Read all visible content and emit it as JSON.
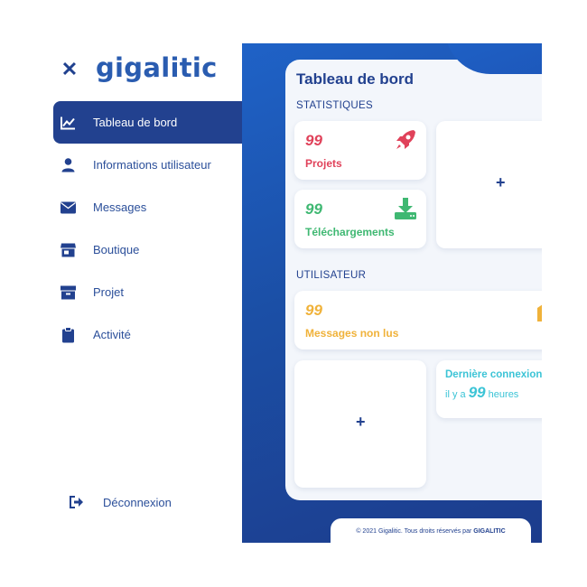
{
  "brand": {
    "name": "gigalitic"
  },
  "sidebar": {
    "items": [
      {
        "label": "Tableau de bord",
        "icon": "chart-line-icon",
        "active": true
      },
      {
        "label": "Informations utilisateur",
        "icon": "user-icon"
      },
      {
        "label": "Messages",
        "icon": "envelope-icon"
      },
      {
        "label": "Boutique",
        "icon": "store-icon"
      },
      {
        "label": "Projet",
        "icon": "box-icon"
      },
      {
        "label": "Activité",
        "icon": "clipboard-icon"
      }
    ],
    "logout": {
      "label": "Déconnexion",
      "icon": "sign-out-icon"
    }
  },
  "dashboard": {
    "title": "Tableau de bord",
    "statistics_label": "STATISTIQUES",
    "user_label": "UTILISATEUR",
    "projects": {
      "value": "99",
      "label": "Projets",
      "icon": "rocket-icon",
      "color": "#e0425a"
    },
    "downloads": {
      "value": "99",
      "label": "Téléchargements",
      "icon": "download-icon",
      "color": "#3fb872"
    },
    "unread": {
      "value": "99",
      "label": "Messages non lus",
      "icon": "envelope-open-icon",
      "color": "#f0b23a"
    },
    "last_login": {
      "label": "Dernière connexion",
      "prefix": "il y a",
      "value": "99",
      "suffix": "heures",
      "color": "#3cc4d6"
    },
    "add_symbol": "+"
  },
  "footer": {
    "text": "© 2021 Gigalitic. Tous droits réservés par",
    "brand": "GIGALITIC"
  },
  "colors": {
    "primary": "#22418f",
    "panel_blue": "#1f62c7",
    "text_blue": "#2b4f9a"
  }
}
